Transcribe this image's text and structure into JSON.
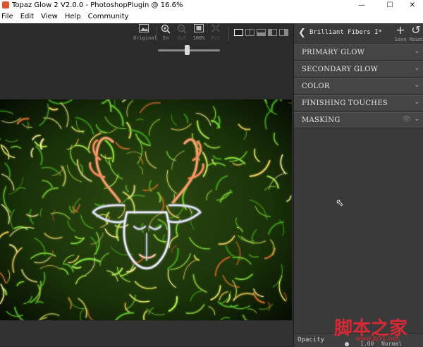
{
  "window": {
    "title": "Topaz Glow 2 V2.0.0 - PhotoshopPlugin @ 16.6%",
    "minimize": "—",
    "maximize": "☐",
    "close": "✕"
  },
  "menu": [
    "File",
    "Edit",
    "View",
    "Help",
    "Community"
  ],
  "toolbar": {
    "original": {
      "label": "Original",
      "icon": "image-icon"
    },
    "zoom_in": {
      "label": "In",
      "icon": "zoom-in-icon"
    },
    "zoom_out": {
      "label": "Out",
      "icon": "zoom-out-icon"
    },
    "zoom_100": {
      "label": "100%",
      "icon": "actual-size-icon"
    },
    "fit": {
      "label": "Fit",
      "icon": "fit-icon"
    },
    "zoom_slider_level": 0.47
  },
  "panel": {
    "preset_name": "Brilliant Fibers I*",
    "save_label": "Save",
    "reset_label": "Reset",
    "sections": [
      "PRIMARY GLOW",
      "SECONDARY GLOW",
      "COLOR",
      "FINISHING TOUCHES",
      "MASKING"
    ],
    "opacity_label": "Opacity",
    "opacity_value": "1.00",
    "blend_mode": "Normal"
  },
  "watermark": {
    "text": "脚本之家",
    "url": "www.jb51.net"
  },
  "colors": {
    "panel_bg": "#3a3a3a",
    "canvas_bg": "#2b2b2b",
    "watermark": "#d52a35"
  }
}
